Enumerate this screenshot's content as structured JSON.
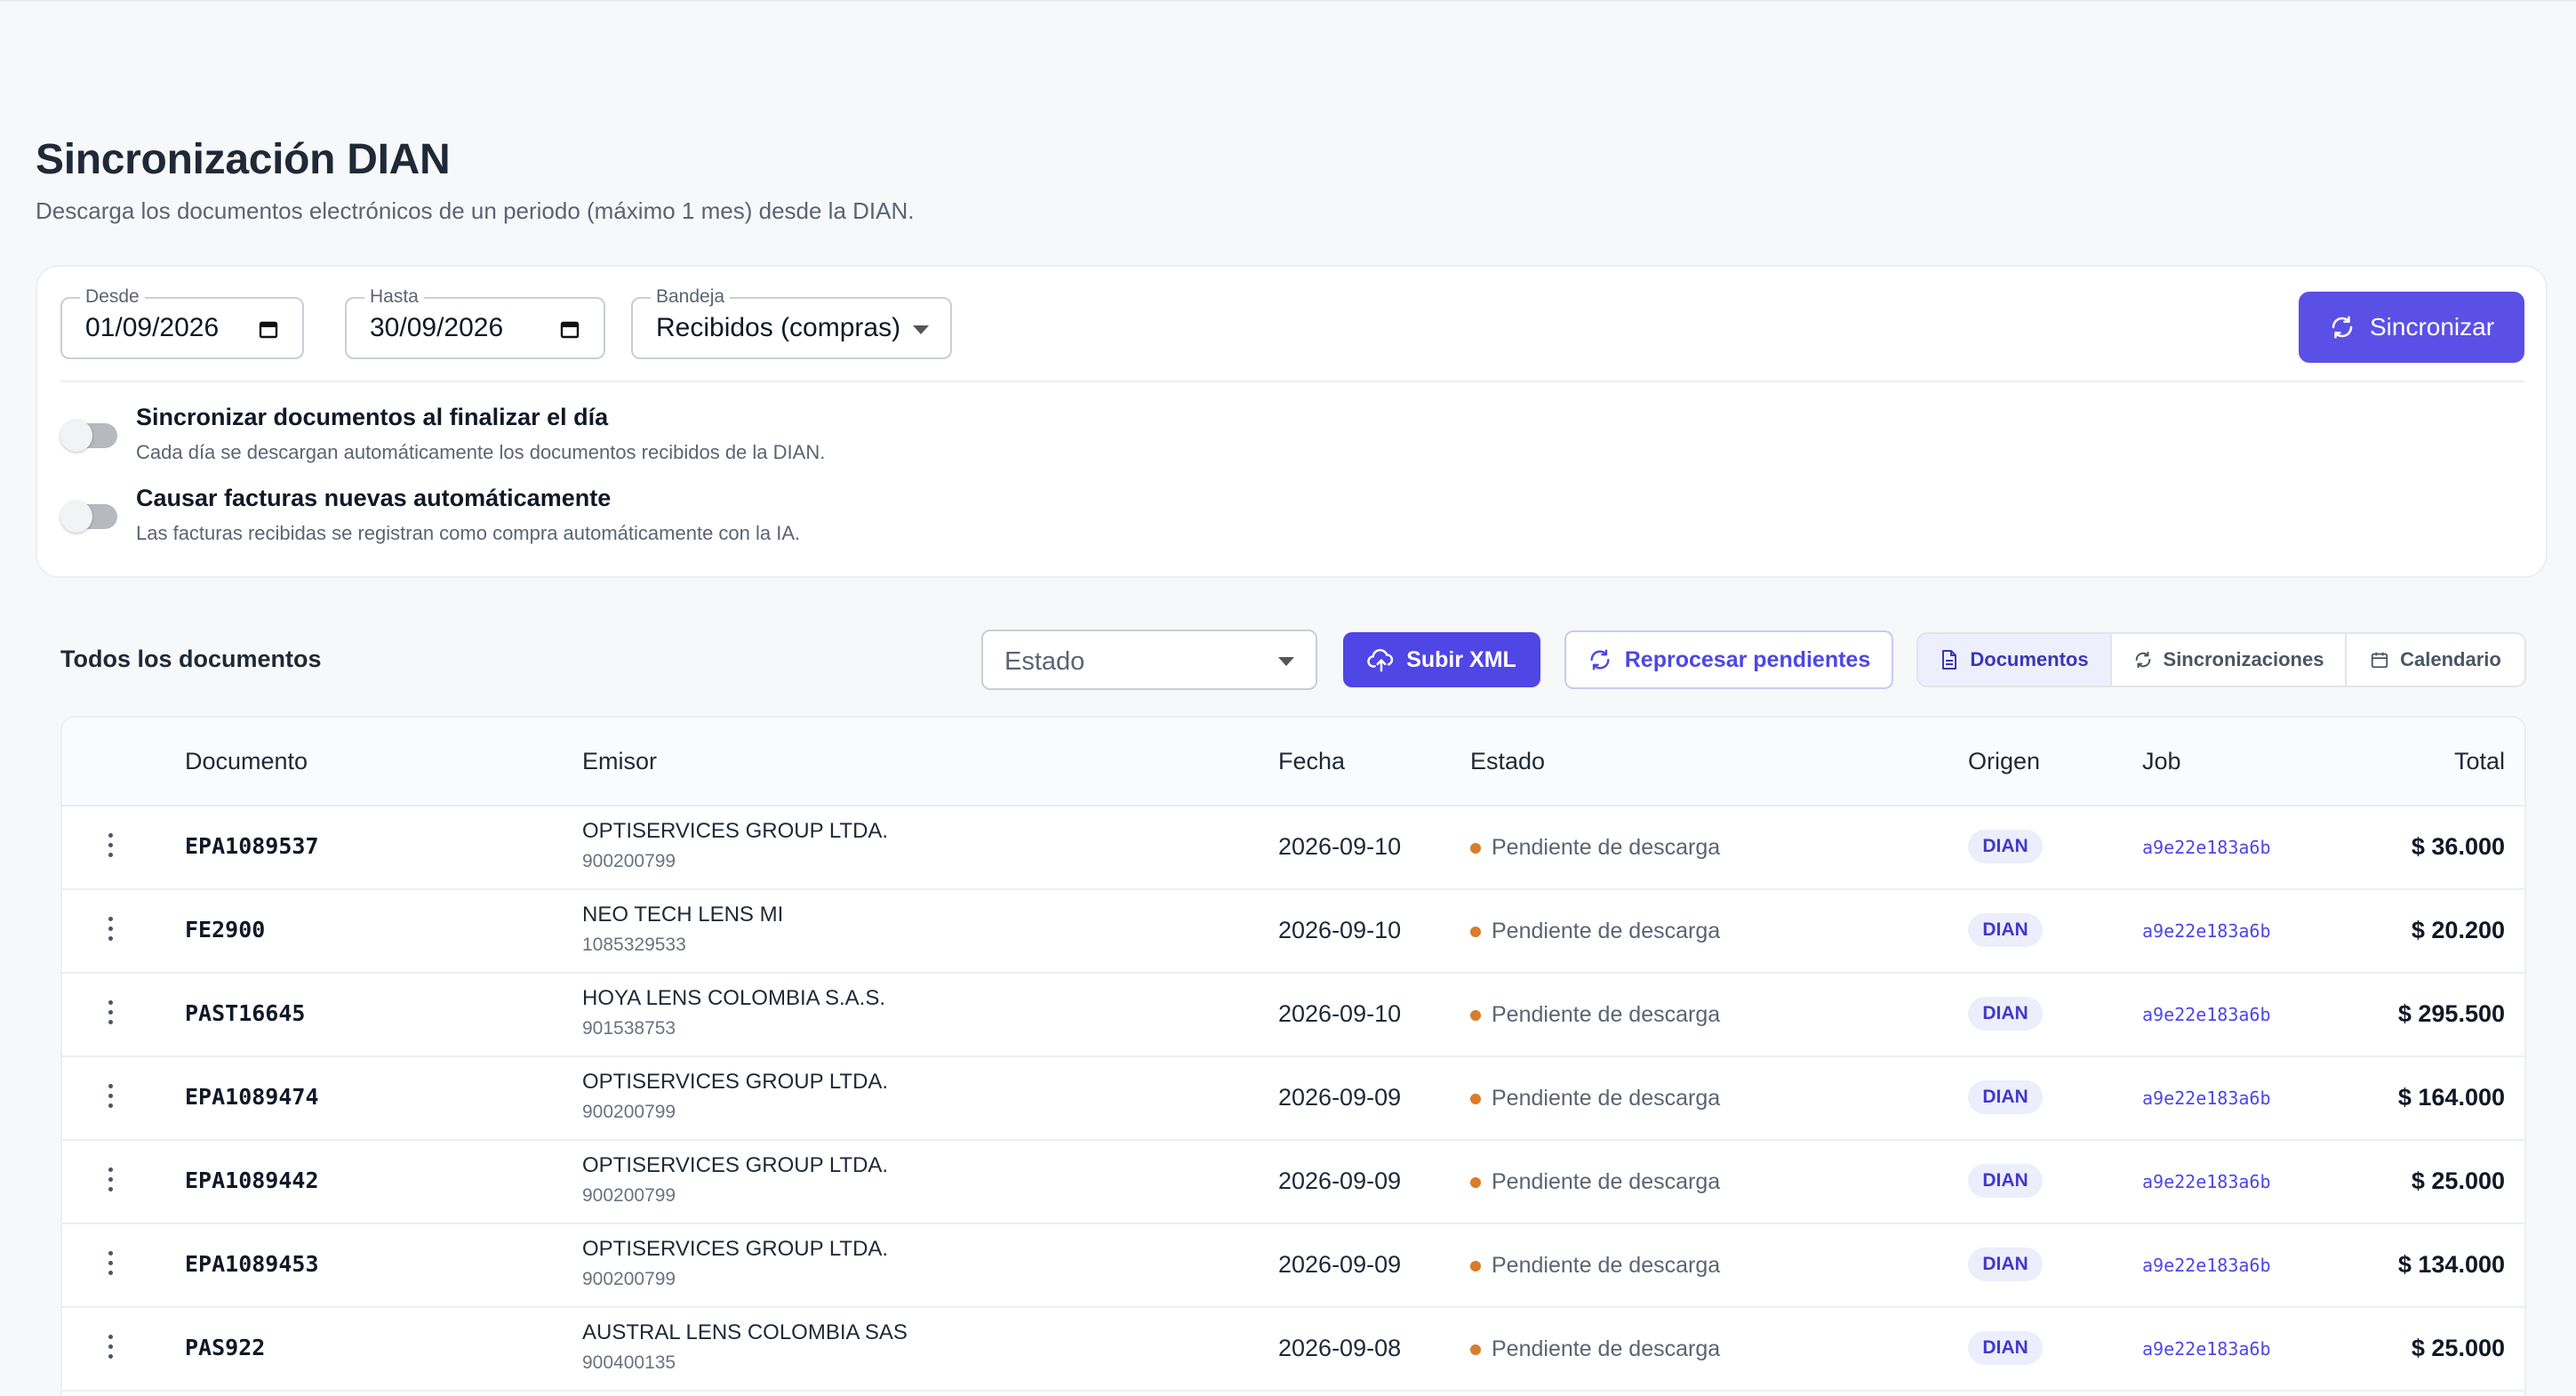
{
  "header": {
    "title": "Sincronización DIAN",
    "subtitle": "Descarga los documentos electrónicos de un periodo (máximo 1 mes) desde la DIAN."
  },
  "sync_form": {
    "desde": {
      "label": "Desde",
      "value": "01/09/2026"
    },
    "hasta": {
      "label": "Hasta",
      "value": "30/09/2026"
    },
    "bandeja": {
      "label": "Bandeja",
      "value": "Recibidos (compras)"
    },
    "sync_button": "Sincronizar"
  },
  "options": [
    {
      "title": "Sincronizar documentos al finalizar el día",
      "description": "Cada día se descargan automáticamente los documentos recibidos de la DIAN.",
      "enabled": false
    },
    {
      "title": "Causar facturas nuevas automáticamente",
      "description": "Las facturas recibidas se registran como compra automáticamente con la IA.",
      "enabled": false
    }
  ],
  "toolbar": {
    "section_title": "Todos los documentos",
    "estado_placeholder": "Estado",
    "upload_xml": "Subir XML",
    "reprocess": "Reprocesar pendientes",
    "tabs": [
      {
        "label": "Documentos",
        "icon": "document-icon",
        "active": true
      },
      {
        "label": "Sincronizaciones",
        "icon": "sync-icon",
        "active": false
      },
      {
        "label": "Calendario",
        "icon": "calendar-icon",
        "active": false
      }
    ]
  },
  "table": {
    "columns": [
      "Documento",
      "Emisor",
      "Fecha",
      "Estado",
      "Origen",
      "Job",
      "Total"
    ],
    "rows": [
      {
        "documento": "EPA1089537",
        "emisor": "OPTISERVICES GROUP LTDA.",
        "nit": "900200799",
        "fecha": "2026-09-10",
        "estado": "Pendiente de descarga",
        "origen": "DIAN",
        "job": "a9e22e183a6b",
        "total": "$ 36.000"
      },
      {
        "documento": "FE2900",
        "emisor": "NEO TECH LENS MI",
        "nit": "1085329533",
        "fecha": "2026-09-10",
        "estado": "Pendiente de descarga",
        "origen": "DIAN",
        "job": "a9e22e183a6b",
        "total": "$ 20.200"
      },
      {
        "documento": "PAST16645",
        "emisor": "HOYA LENS COLOMBIA S.A.S.",
        "nit": "901538753",
        "fecha": "2026-09-10",
        "estado": "Pendiente de descarga",
        "origen": "DIAN",
        "job": "a9e22e183a6b",
        "total": "$ 295.500"
      },
      {
        "documento": "EPA1089474",
        "emisor": "OPTISERVICES GROUP LTDA.",
        "nit": "900200799",
        "fecha": "2026-09-09",
        "estado": "Pendiente de descarga",
        "origen": "DIAN",
        "job": "a9e22e183a6b",
        "total": "$ 164.000"
      },
      {
        "documento": "EPA1089442",
        "emisor": "OPTISERVICES GROUP LTDA.",
        "nit": "900200799",
        "fecha": "2026-09-09",
        "estado": "Pendiente de descarga",
        "origen": "DIAN",
        "job": "a9e22e183a6b",
        "total": "$ 25.000"
      },
      {
        "documento": "EPA1089453",
        "emisor": "OPTISERVICES GROUP LTDA.",
        "nit": "900200799",
        "fecha": "2026-09-09",
        "estado": "Pendiente de descarga",
        "origen": "DIAN",
        "job": "a9e22e183a6b",
        "total": "$ 134.000"
      },
      {
        "documento": "PAS922",
        "emisor": "AUSTRAL LENS COLOMBIA SAS",
        "nit": "900400135",
        "fecha": "2026-09-08",
        "estado": "Pendiente de descarga",
        "origen": "DIAN",
        "job": "a9e22e183a6b",
        "total": "$ 25.000"
      }
    ]
  },
  "colors": {
    "primary": "#5b50e6",
    "primary_dark": "#4f46e5",
    "status_pending": "#d97c2b",
    "badge_bg": "#eceefb"
  }
}
